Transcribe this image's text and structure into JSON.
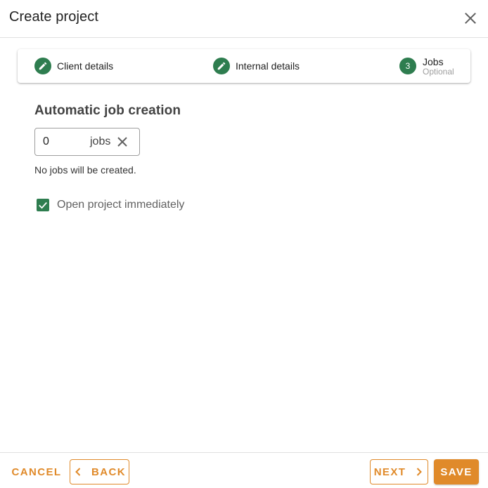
{
  "dialog": {
    "title": "Create project"
  },
  "stepper": {
    "steps": [
      {
        "label": "Client details",
        "state": "edit",
        "icon": "pencil-icon"
      },
      {
        "label": "Internal details",
        "state": "edit",
        "icon": "pencil-icon"
      },
      {
        "label": "Jobs",
        "number": "3",
        "sublabel": "Optional",
        "state": "active"
      }
    ]
  },
  "jobs": {
    "section_title": "Automatic job creation",
    "count_value": "0",
    "suffix": "jobs",
    "hint": "No jobs will be created."
  },
  "options": {
    "open_immediately_label": "Open project immediately",
    "open_immediately_checked": true
  },
  "footer": {
    "cancel_label": "CANCEL",
    "back_label": "BACK",
    "next_label": "NEXT",
    "save_label": "SAVE"
  },
  "colors": {
    "accent": "#e08a2a",
    "step_complete": "#2e7d4f",
    "checkbox": "#2e7d4f"
  }
}
